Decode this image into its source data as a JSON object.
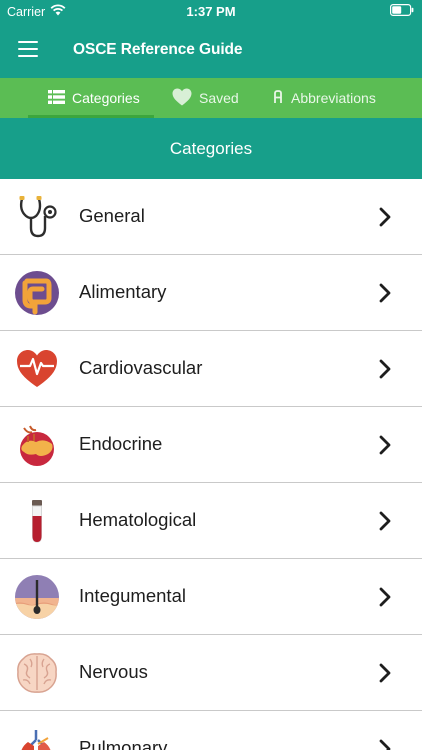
{
  "status_bar": {
    "carrier": "Carrier",
    "time": "1:37 PM"
  },
  "nav": {
    "title": "OSCE Reference Guide"
  },
  "tabs": [
    {
      "label": "Categories",
      "icon": "list-icon",
      "active": true
    },
    {
      "label": "Saved",
      "icon": "heart-icon",
      "active": false
    },
    {
      "label": "Abbreviations",
      "icon": "abbreviation-icon",
      "active": false
    }
  ],
  "section": {
    "title": "Categories"
  },
  "categories": [
    {
      "label": "General",
      "icon": "stethoscope-icon"
    },
    {
      "label": "Alimentary",
      "icon": "intestine-icon"
    },
    {
      "label": "Cardiovascular",
      "icon": "heart-pulse-icon"
    },
    {
      "label": "Endocrine",
      "icon": "gland-icon"
    },
    {
      "label": "Hematological",
      "icon": "blood-tube-icon"
    },
    {
      "label": "Integumental",
      "icon": "skin-hair-icon"
    },
    {
      "label": "Nervous",
      "icon": "brain-icon"
    },
    {
      "label": "Pulmonary",
      "icon": "lungs-icon"
    }
  ],
  "colors": {
    "primary": "#179f8a",
    "tab_bar": "#5bbd54",
    "tab_underline": "#3ca63d"
  }
}
